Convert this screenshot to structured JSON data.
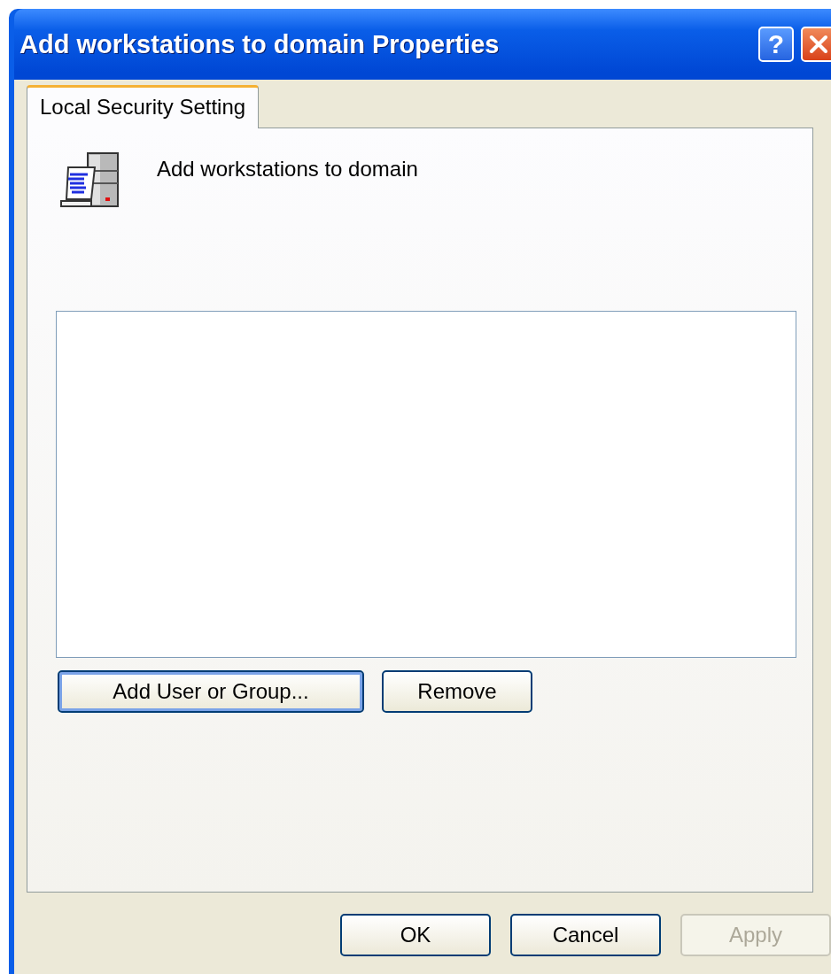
{
  "window": {
    "title": "Add workstations to domain Properties",
    "help_button": "?"
  },
  "tabs": [
    {
      "label": "Local Security Setting",
      "selected": true
    }
  ],
  "policy": {
    "name": "Add workstations to domain"
  },
  "list_buttons": [
    {
      "label": "Add User or Group...",
      "focused": true,
      "disabled": false
    },
    {
      "label": "Remove",
      "focused": false,
      "disabled": false
    }
  ],
  "dialog_buttons": [
    {
      "label": "OK",
      "focused": false,
      "disabled": false
    },
    {
      "label": "Cancel",
      "focused": false,
      "disabled": false
    },
    {
      "label": "Apply",
      "focused": false,
      "disabled": true
    }
  ]
}
